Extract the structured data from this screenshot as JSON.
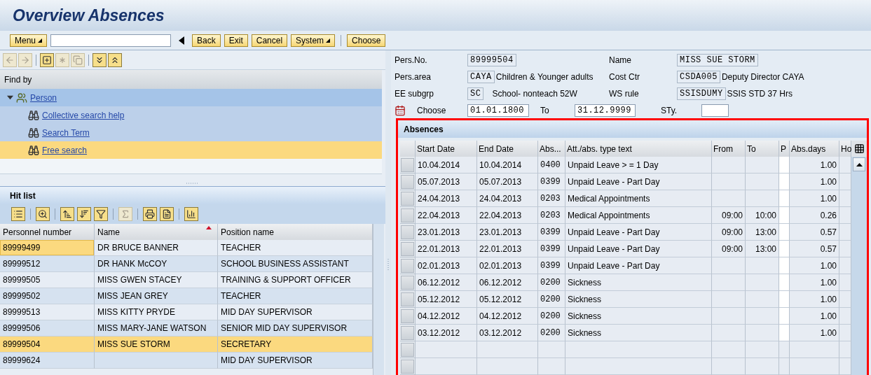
{
  "title": "Overview Absences",
  "toolbar": {
    "buttons": [
      {
        "label": "Menu",
        "kind": "dropdown"
      },
      {
        "label": "Back",
        "kind": "plain"
      },
      {
        "label": "Exit",
        "kind": "plain"
      },
      {
        "label": "Cancel",
        "kind": "plain"
      },
      {
        "label": "System",
        "kind": "dropdown"
      }
    ],
    "action_buttons": [
      "Choose"
    ]
  },
  "find_by": {
    "title": "Find by",
    "items": [
      {
        "label": "Person",
        "expanded": true,
        "selected": false,
        "children": [
          {
            "label": "Collective search help",
            "selected": false
          },
          {
            "label": "Search Term",
            "selected": false
          },
          {
            "label": "Free search",
            "selected": true
          }
        ]
      }
    ]
  },
  "hit_list": {
    "title": "Hit list",
    "columns": [
      {
        "label": "Personnel number",
        "sorted": false
      },
      {
        "label": "Name",
        "sorted": true
      },
      {
        "label": "Position name",
        "sorted": false
      }
    ],
    "rows": [
      {
        "cells": [
          "89999499",
          "DR BRUCE BANNER",
          "TEACHER"
        ],
        "selected": false,
        "current": true
      },
      {
        "cells": [
          "89999512",
          "DR HANK McCOY",
          "SCHOOL BUSINESS ASSISTANT"
        ],
        "selected": false,
        "current": false
      },
      {
        "cells": [
          "89999505",
          "MISS GWEN STACEY",
          "TRAINING & SUPPORT OFFICER"
        ],
        "selected": false,
        "current": false
      },
      {
        "cells": [
          "89999502",
          "MISS JEAN GREY",
          "TEACHER"
        ],
        "selected": false,
        "current": false
      },
      {
        "cells": [
          "89999513",
          "MISS KITTY PRYDE",
          "MID DAY SUPERVISOR"
        ],
        "selected": false,
        "current": false
      },
      {
        "cells": [
          "89999506",
          "MISS MARY-JANE WATSON",
          "SENIOR MID DAY SUPERVISOR"
        ],
        "selected": false,
        "current": false
      },
      {
        "cells": [
          "89999504",
          "MISS SUE STORM",
          "SECRETARY"
        ],
        "selected": true,
        "current": false
      },
      {
        "cells": [
          "89999624",
          "",
          "MID DAY SUPERVISOR"
        ],
        "selected": false,
        "current": false
      }
    ]
  },
  "header_fields": [
    {
      "label": "Pers.No.",
      "value": "89999504"
    },
    {
      "label": "Name",
      "value": "MISS SUE STORM"
    },
    {
      "label": "Pers.area",
      "value": "CAYA",
      "text": "Children & Younger adults"
    },
    {
      "label": "Cost Ctr",
      "value": "CSDA005",
      "text": "Deputy Director CAYA"
    },
    {
      "label": "EE subgrp",
      "value": "SC",
      "text": "School- nonteach 52W"
    },
    {
      "label": "WS rule",
      "value": "SSISDUMY",
      "text": "SSIS STD 37 Hrs"
    }
  ],
  "period": {
    "choose_label": "Choose",
    "from": "01.01.1800",
    "to_label": "To",
    "to": "31.12.9999",
    "type_label": "STy."
  },
  "absences": {
    "title": "Absences",
    "highlighted": true,
    "columns": [
      {
        "label": "Start Date",
        "kind": "date"
      },
      {
        "label": "End Date",
        "kind": "date"
      },
      {
        "label": "Abs...",
        "kind": "code"
      },
      {
        "label": "Att./abs. type text",
        "kind": "text"
      },
      {
        "label": "From",
        "kind": "time"
      },
      {
        "label": "To",
        "kind": "time"
      },
      {
        "label": "P",
        "kind": "flag"
      },
      {
        "label": "Abs.days",
        "kind": "number"
      },
      {
        "label": "Ho",
        "kind": "text"
      }
    ],
    "rows": [
      {
        "start": "10.04.2014",
        "end": "10.04.2014",
        "abs": "0400",
        "type": "Unpaid Leave > = 1 Day",
        "days": "1.00"
      },
      {
        "start": "05.07.2013",
        "end": "05.07.2013",
        "abs": "0399",
        "type": "Unpaid Leave - Part Day",
        "days": "1.00"
      },
      {
        "start": "24.04.2013",
        "end": "24.04.2013",
        "abs": "0203",
        "type": "Medical Appointments",
        "days": "1.00"
      },
      {
        "start": "22.04.2013",
        "end": "22.04.2013",
        "abs": "0203",
        "type": "Medical Appointments",
        "from": "09:00",
        "to": "10:00",
        "days": "0.26"
      },
      {
        "start": "23.01.2013",
        "end": "23.01.2013",
        "abs": "0399",
        "type": "Unpaid Leave - Part Day",
        "from": "09:00",
        "to": "13:00",
        "days": "0.57"
      },
      {
        "start": "22.01.2013",
        "end": "22.01.2013",
        "abs": "0399",
        "type": "Unpaid Leave - Part Day",
        "from": "09:00",
        "to": "13:00",
        "days": "0.57"
      },
      {
        "start": "02.01.2013",
        "end": "02.01.2013",
        "abs": "0399",
        "type": "Unpaid Leave - Part Day",
        "days": "1.00"
      },
      {
        "start": "06.12.2012",
        "end": "06.12.2012",
        "abs": "0200",
        "type": "Sickness",
        "days": "1.00"
      },
      {
        "start": "05.12.2012",
        "end": "05.12.2012",
        "abs": "0200",
        "type": "Sickness",
        "days": "1.00"
      },
      {
        "start": "04.12.2012",
        "end": "04.12.2012",
        "abs": "0200",
        "type": "Sickness",
        "days": "1.00"
      },
      {
        "start": "03.12.2012",
        "end": "03.12.2012",
        "abs": "0200",
        "type": "Sickness",
        "days": "1.00"
      }
    ]
  }
}
